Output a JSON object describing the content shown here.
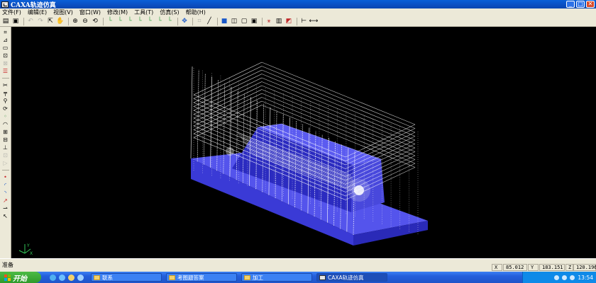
{
  "window": {
    "title": "CAXA轨迹仿真",
    "controls": {
      "minimize": "_",
      "maximize": "□",
      "close": "✕"
    }
  },
  "menu": [
    "文件(F)",
    "编辑(E)",
    "视图(V)",
    "窗口(W)",
    "修改(M)",
    "工具(T)",
    "仿真(S)",
    "帮助(H)"
  ],
  "toolbar": {
    "icons": [
      "open-icon",
      "save-icon",
      "undo-icon",
      "redo-icon",
      "select-icon",
      "pan-icon",
      "zoom-in-icon",
      "zoom-out-icon",
      "rotate-icon",
      "view-front-icon",
      "view-back-icon",
      "view-left-icon",
      "view-right-icon",
      "view-top-icon",
      "view-bottom-icon",
      "view-iso-icon",
      "move-icon",
      "measure-icon",
      "pick-icon",
      "solid-icon",
      "wire-icon",
      "frame-icon",
      "box-icon",
      "tool-path-icon",
      "color-icon",
      "section-icon",
      "ruler-icon"
    ]
  },
  "left_toolbar": {
    "icons": [
      "crop-icon",
      "shape-icon",
      "rect-icon",
      "zoom-window-icon",
      "layer-icon",
      "list-icon",
      "cut-icon",
      "stock-icon",
      "tool-icon",
      "spin-icon",
      "node-icon",
      "arc-icon",
      "tool-holder-icon",
      "mill-icon",
      "point-icon",
      "extend-icon",
      "path-icon",
      "curve-icon",
      "circle-icon",
      "line-icon",
      "arrow-icon",
      "cursor-icon"
    ]
  },
  "viewport": {
    "background": "#000000",
    "stock_color": "#4a4ae8",
    "toolpath_color": "#ffffff",
    "axis_color": "#34c759"
  },
  "status": {
    "message": "准备",
    "coords": [
      "X",
      "85.012",
      "Y",
      "183.151",
      "Z",
      "120.196"
    ]
  },
  "taskbar": {
    "start_label": "开始",
    "tasks": [
      {
        "label": "联系",
        "active": false
      },
      {
        "label": "考图题答案",
        "active": false
      },
      {
        "label": "加工",
        "active": false
      },
      {
        "label": "CAXA轨迹仿真",
        "active": true
      }
    ],
    "clock": "13:54"
  }
}
